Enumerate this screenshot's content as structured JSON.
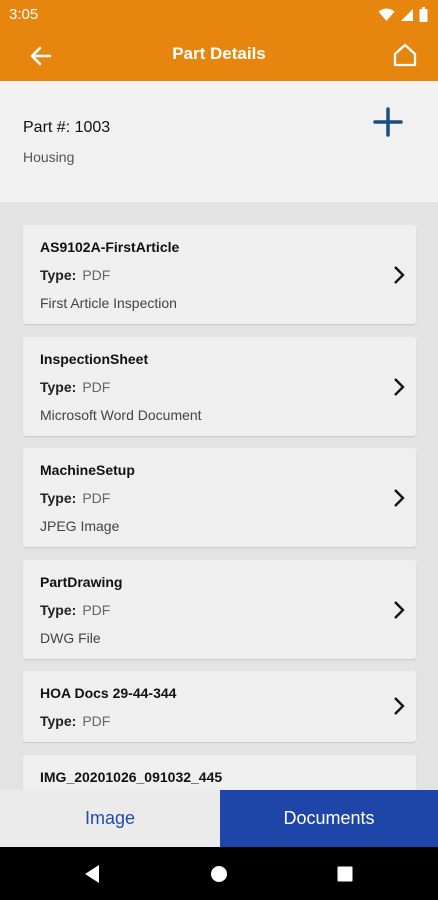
{
  "status": {
    "time": "3:05"
  },
  "header": {
    "title": "Part Details"
  },
  "part": {
    "number": "Part #: 1003",
    "description": "Housing"
  },
  "type_label": "Type:",
  "documents": [
    {
      "name": "AS9102A-FirstArticle",
      "type": "PDF",
      "description": "First Article Inspection"
    },
    {
      "name": "InspectionSheet",
      "type": "PDF",
      "description": "Microsoft Word Document"
    },
    {
      "name": "MachineSetup",
      "type": "PDF",
      "description": "JPEG Image"
    },
    {
      "name": "PartDrawing",
      "type": "PDF",
      "description": "DWG File"
    },
    {
      "name": "HOA Docs 29-44-344",
      "type": "PDF",
      "description": ""
    },
    {
      "name": "IMG_20201026_091032_445",
      "type": "",
      "description": ""
    }
  ],
  "tabs": {
    "image": "Image",
    "documents": "Documents"
  },
  "colors": {
    "accent": "#e7860f",
    "primary": "#1e46a8"
  }
}
